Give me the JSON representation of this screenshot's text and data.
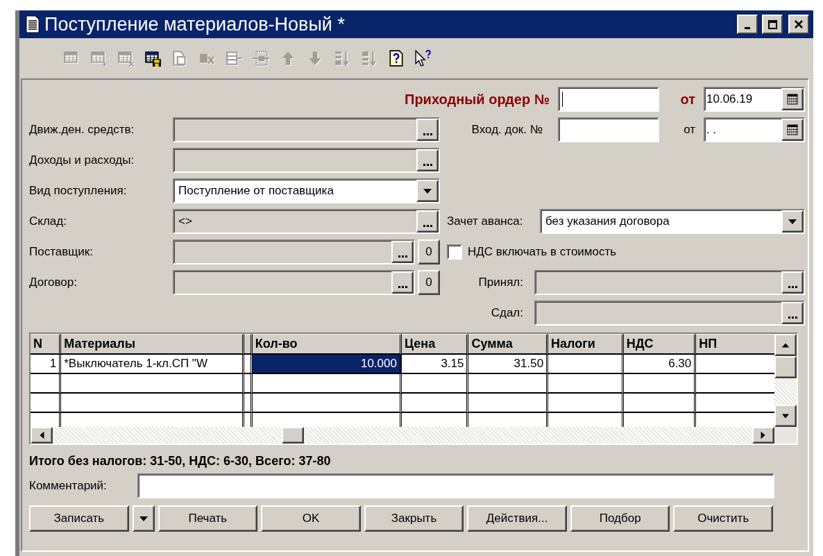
{
  "window": {
    "title": "Поступление материалов-Новый *"
  },
  "toolbar": [
    {
      "kind": "table",
      "disabled": true
    },
    {
      "kind": "table-add",
      "disabled": true
    },
    {
      "kind": "table-delete",
      "disabled": true
    },
    {
      "kind": "table-save",
      "disabled": false
    },
    {
      "kind": "doc-copy",
      "disabled": true
    },
    {
      "kind": "doc-delete",
      "disabled": true
    },
    {
      "kind": "row-edit",
      "disabled": true
    },
    {
      "kind": "row-insert",
      "disabled": true
    },
    {
      "kind": "arrow-up",
      "disabled": true
    },
    {
      "kind": "arrow-down",
      "disabled": true
    },
    {
      "kind": "sort-asc",
      "disabled": true
    },
    {
      "kind": "sort-desc",
      "disabled": true
    },
    {
      "kind": "help",
      "disabled": false
    },
    {
      "kind": "help-pointer",
      "disabled": false
    }
  ],
  "order": {
    "label": "Приходный ордер №",
    "focused": true,
    "date_label": "от",
    "date": "10.06.19"
  },
  "incoming_doc": {
    "label": "Вход. док. №",
    "focused": false,
    "date_label": "от",
    "date": ". ."
  },
  "fields": [
    {
      "label": "Движ.ден. средств:",
      "kind": "reference"
    },
    {
      "label": "Доходы и расходы:",
      "kind": "reference"
    },
    {
      "label": "Вид поступления:",
      "kind": "select",
      "value": "Поступление от поставщика"
    },
    {
      "label": "Склад:",
      "kind": "reference",
      "value": "<>"
    },
    {
      "label": "Поставщик:",
      "kind": "reference",
      "extra_button": "0"
    },
    {
      "label": "Договор:",
      "kind": "reference",
      "extra_button": "0"
    }
  ],
  "advance": {
    "label": "Зачет аванса:",
    "kind": "select",
    "value": "без указания договора"
  },
  "vat_checkbox": {
    "label": "НДС включать в стоимость",
    "checked": false
  },
  "signers": [
    {
      "label": "Принял:",
      "kind": "reference"
    },
    {
      "label": "Сдал:",
      "kind": "reference"
    }
  ],
  "table": {
    "columns": [
      {
        "label": "N",
        "frozen_divider": false
      },
      {
        "label": "Материалы",
        "frozen_divider": true
      },
      {
        "label": "Кол-во",
        "frozen_divider": false
      },
      {
        "label": "Цена",
        "frozen_divider": false
      },
      {
        "label": "Сумма",
        "frozen_divider": false
      },
      {
        "label": "Налоги",
        "frozen_divider": false
      },
      {
        "label": "НДС",
        "frozen_divider": false
      },
      {
        "label": "НП",
        "frozen_divider": false
      }
    ],
    "rows": [
      {
        "cells": [
          {
            "text": "1",
            "selected": false
          },
          {
            "text": "*Выключатель 1-кл.СП \"W",
            "selected": false
          },
          {
            "text": "10.000",
            "selected": true
          },
          {
            "text": "3.15",
            "selected": false
          },
          {
            "text": "31.50",
            "selected": false
          },
          {
            "selected": false
          },
          {
            "text": "6.30",
            "selected": false
          },
          {
            "selected": false
          }
        ]
      }
    ]
  },
  "totals": "Итого без налогов: 31-50, НДС: 6-30, Всего: 37-80",
  "comment": {
    "label": "Комментарий:"
  },
  "buttons": [
    {
      "kind": "button",
      "label": "Записать"
    },
    {
      "kind": "split-arrow"
    },
    {
      "kind": "button",
      "label": "Печать"
    },
    {
      "kind": "button",
      "label": "OK"
    },
    {
      "kind": "button",
      "label": "Закрыть"
    },
    {
      "kind": "button",
      "label": "Действия..."
    },
    {
      "kind": "button",
      "label": "Подбор"
    },
    {
      "kind": "button",
      "label": "Очистить"
    }
  ]
}
